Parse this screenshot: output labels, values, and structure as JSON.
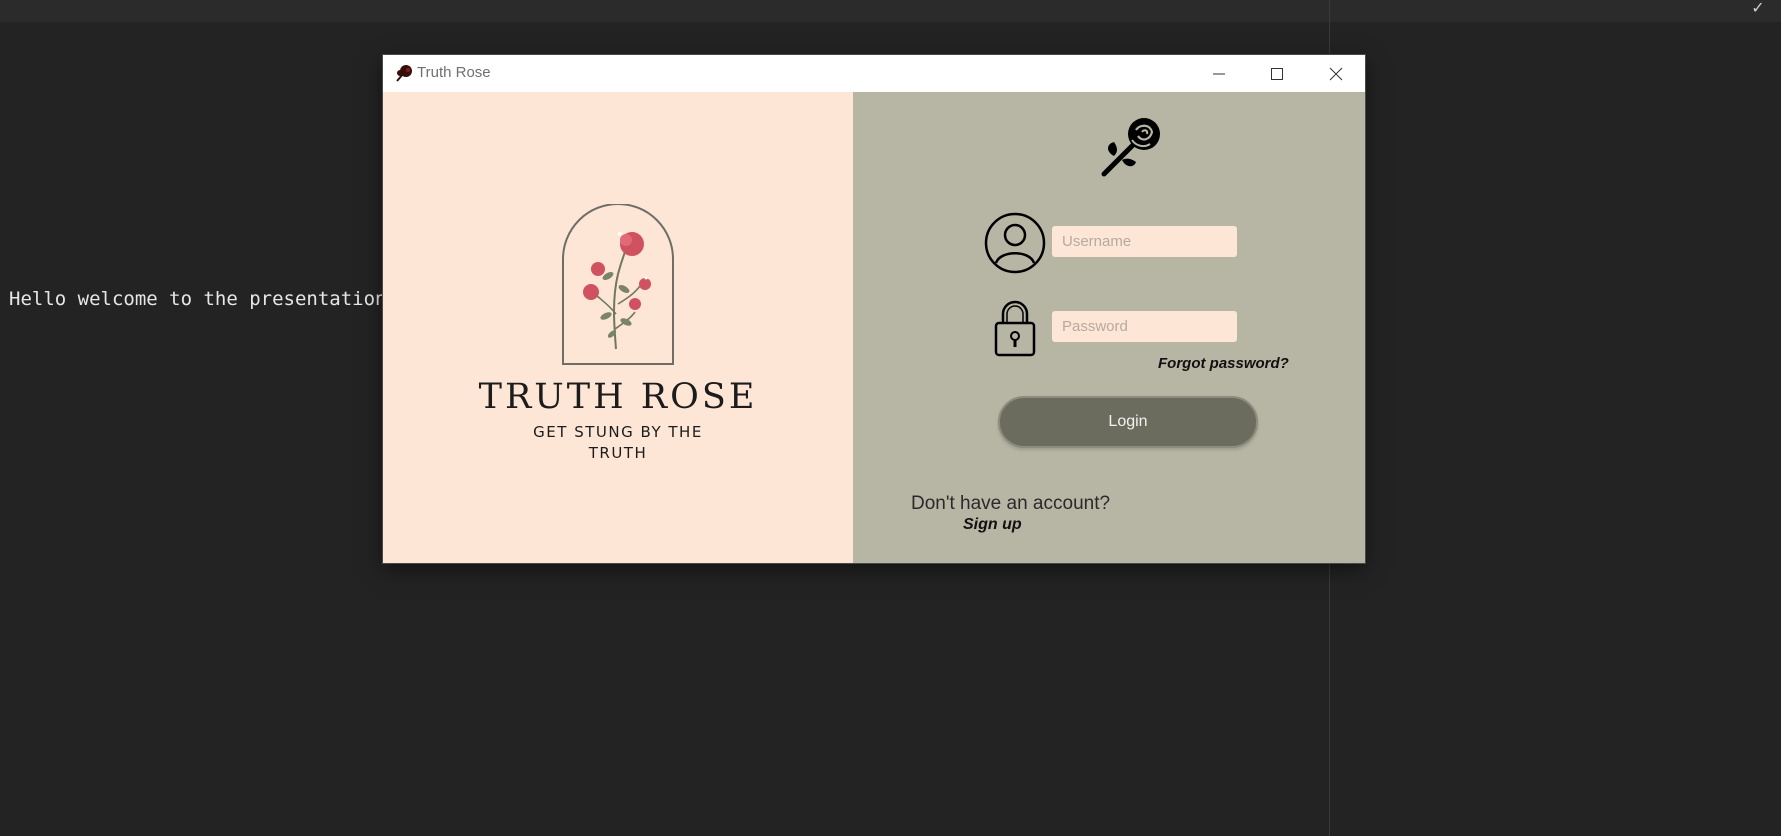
{
  "console": {
    "text": "Hello welcome to the presentation"
  },
  "window": {
    "title": "Truth Rose",
    "controls": {
      "minimize": "minimize-icon",
      "maximize": "maximize-icon",
      "close": "close-icon"
    }
  },
  "branding": {
    "title": "TRUTH ROSE",
    "tagline": "GET STUNG BY THE TRUTH"
  },
  "login": {
    "username_placeholder": "Username",
    "username_value": "",
    "password_placeholder": "Password",
    "password_value": "",
    "forgot_label": "Forgot password?",
    "login_label": "Login",
    "no_account_text": "Don't have an account?",
    "signup_label": "Sign up"
  },
  "colors": {
    "left_panel": "#fde6d6",
    "right_panel": "#b7b6a5",
    "button": "#6b6c5d",
    "rose": "#d0515f",
    "leaf": "#7a8466"
  },
  "icons": [
    "rose-logo-icon",
    "user-avatar-icon",
    "padlock-icon",
    "check-icon"
  ]
}
